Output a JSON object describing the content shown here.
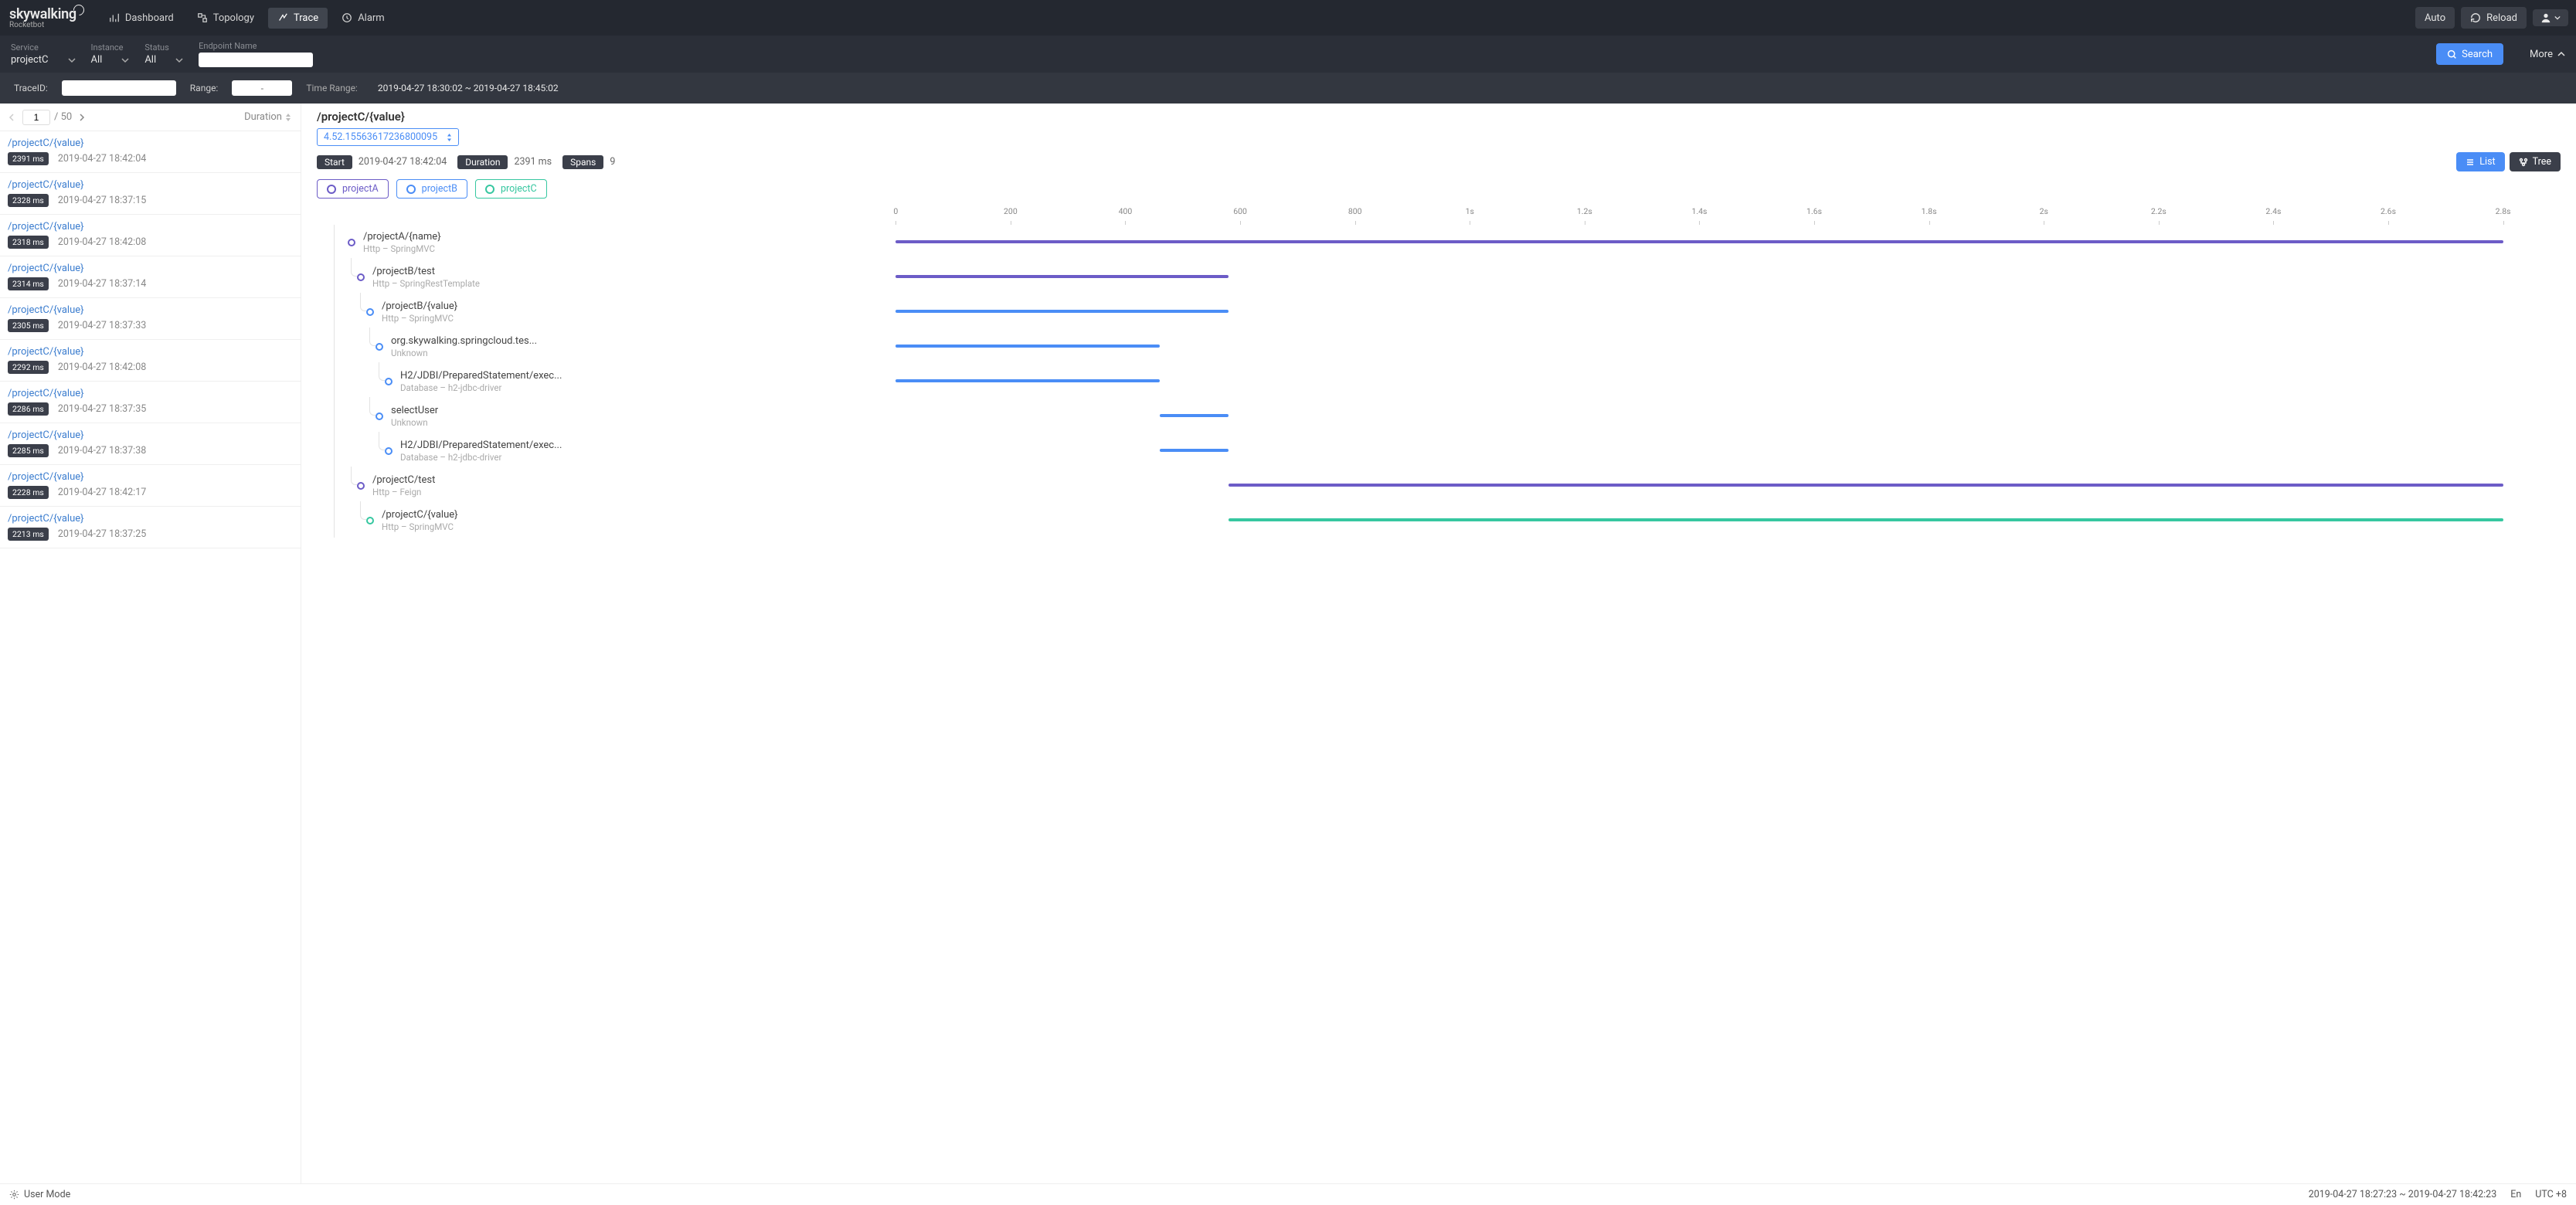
{
  "brand": {
    "title": "skywalking",
    "sub": "Rocketbot"
  },
  "nav": {
    "dashboard": "Dashboard",
    "topology": "Topology",
    "trace": "Trace",
    "alarm": "Alarm"
  },
  "topbar": {
    "auto": "Auto",
    "reload": "Reload"
  },
  "filters": {
    "service_label": "Service",
    "service_value": "projectC",
    "instance_label": "Instance",
    "instance_value": "All",
    "status_label": "Status",
    "status_value": "All",
    "endpoint_label": "Endpoint Name",
    "search": "Search",
    "more": "More"
  },
  "subfilters": {
    "traceid_label": "TraceID:",
    "range_label": "Range:",
    "range_placeholder": "-",
    "time_range_label": "Time Range:",
    "time_range_value": "2019-04-27 18:30:02 ~ 2019-04-27 18:45:02"
  },
  "pager": {
    "page": "1",
    "total": "/  50",
    "sort": "Duration"
  },
  "trace_list": [
    {
      "title": "/projectC/{value}",
      "duration": "2391 ms",
      "time": "2019-04-27 18:42:04"
    },
    {
      "title": "/projectC/{value}",
      "duration": "2328 ms",
      "time": "2019-04-27 18:37:15"
    },
    {
      "title": "/projectC/{value}",
      "duration": "2318 ms",
      "time": "2019-04-27 18:42:08"
    },
    {
      "title": "/projectC/{value}",
      "duration": "2314 ms",
      "time": "2019-04-27 18:37:14"
    },
    {
      "title": "/projectC/{value}",
      "duration": "2305 ms",
      "time": "2019-04-27 18:37:33"
    },
    {
      "title": "/projectC/{value}",
      "duration": "2292 ms",
      "time": "2019-04-27 18:42:08"
    },
    {
      "title": "/projectC/{value}",
      "duration": "2286 ms",
      "time": "2019-04-27 18:37:35"
    },
    {
      "title": "/projectC/{value}",
      "duration": "2285 ms",
      "time": "2019-04-27 18:37:38"
    },
    {
      "title": "/projectC/{value}",
      "duration": "2228 ms",
      "time": "2019-04-27 18:42:17"
    },
    {
      "title": "/projectC/{value}",
      "duration": "2213 ms",
      "time": "2019-04-27 18:37:25"
    }
  ],
  "detail": {
    "title": "/projectC/{value}",
    "trace_id": "4.52.15563617236800095",
    "start_label": "Start",
    "start_value": "2019-04-27 18:42:04",
    "duration_label": "Duration",
    "duration_value": "2391 ms",
    "spans_label": "Spans",
    "spans_value": "9",
    "list_btn": "List",
    "tree_btn": "Tree"
  },
  "legend": {
    "a": "projectA",
    "b": "projectB",
    "c": "projectC"
  },
  "chart_data": {
    "type": "gantt",
    "xlim": [
      0,
      2.8
    ],
    "xticks": [
      "0",
      "200",
      "400",
      "600",
      "800",
      "1s",
      "1.2s",
      "1.4s",
      "1.6s",
      "1.8s",
      "2s",
      "2.2s",
      "2.4s",
      "2.6s",
      "2.8s"
    ],
    "rows": [
      {
        "name": "/projectA/{name}",
        "sub": "Http  –  SpringMVC",
        "series": "a",
        "indent": 0,
        "start": 0,
        "end": 2.8
      },
      {
        "name": "/projectB/test",
        "sub": "Http  –  SpringRestTemplate",
        "series": "a",
        "indent": 1,
        "start": 0,
        "end": 0.58
      },
      {
        "name": "/projectB/{value}",
        "sub": "Http  –  SpringMVC",
        "series": "b",
        "indent": 2,
        "start": 0,
        "end": 0.58
      },
      {
        "name": "org.skywalking.springcloud.tes...",
        "sub": "Unknown",
        "series": "b",
        "indent": 3,
        "start": 0,
        "end": 0.46
      },
      {
        "name": "H2/JDBI/PreparedStatement/exec...",
        "sub": "Database  –  h2-jdbc-driver",
        "series": "b",
        "indent": 4,
        "start": 0,
        "end": 0.46
      },
      {
        "name": "selectUser",
        "sub": "Unknown",
        "series": "b",
        "indent": 3,
        "start": 0.46,
        "end": 0.58
      },
      {
        "name": "H2/JDBI/PreparedStatement/exec...",
        "sub": "Database  –  h2-jdbc-driver",
        "series": "b",
        "indent": 4,
        "start": 0.46,
        "end": 0.58
      },
      {
        "name": "/projectC/test",
        "sub": "Http  –  Feign",
        "series": "a",
        "indent": 1,
        "start": 0.58,
        "end": 2.8
      },
      {
        "name": "/projectC/{value}",
        "sub": "Http  –  SpringMVC",
        "series": "c",
        "indent": 2,
        "start": 0.58,
        "end": 2.8
      }
    ]
  },
  "footer": {
    "user_mode": "User Mode",
    "time": "2019-04-27 18:27:23 ~ 2019-04-27 18:42:23",
    "lang": "En",
    "tz": "UTC +8"
  }
}
